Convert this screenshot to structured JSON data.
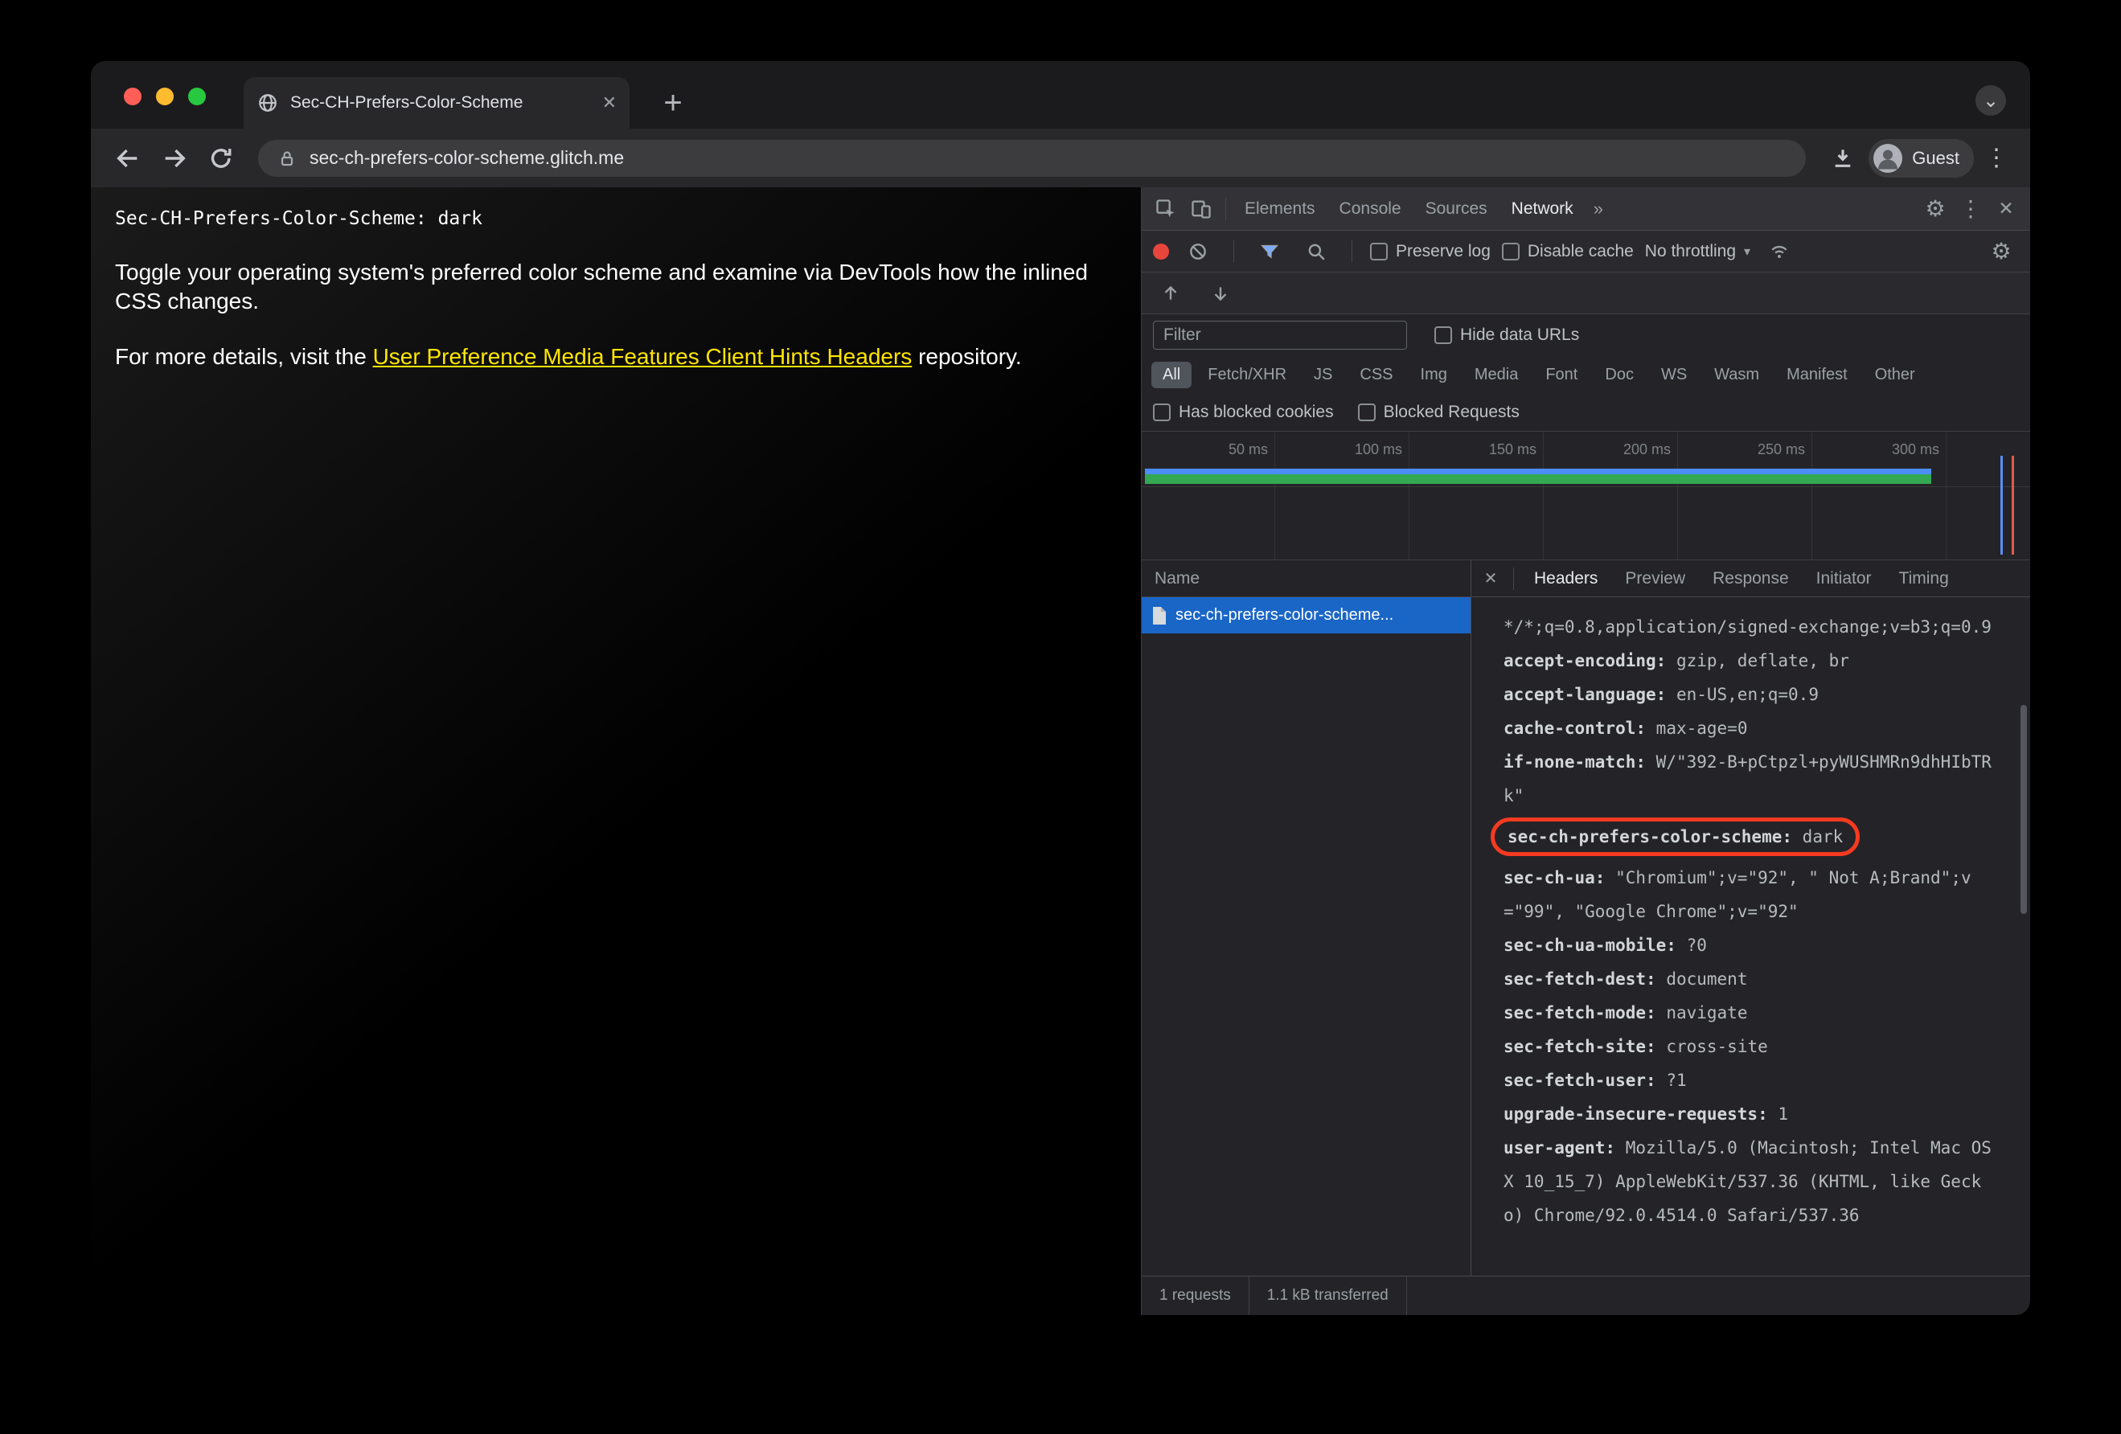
{
  "browser": {
    "tab_title": "Sec-CH-Prefers-Color-Scheme",
    "url": "sec-ch-prefers-color-scheme.glitch.me",
    "profile_label": "Guest"
  },
  "icons": {
    "close": "✕",
    "plus": "+",
    "kebab": "⋮",
    "gear": "⚙",
    "overflow": "»",
    "chevron_down": "▾",
    "collapse_chevron": "⌄"
  },
  "page": {
    "mono_line": "Sec-CH-Prefers-Color-Scheme: dark",
    "para1": "Toggle your operating system's preferred color scheme and examine via DevTools how the inlined CSS changes.",
    "para2_prefix": "For more details, visit the ",
    "link_text": "User Preference Media Features Client Hints Headers",
    "para2_suffix": " repository."
  },
  "devtools": {
    "tabs": [
      {
        "label": "Elements"
      },
      {
        "label": "Console"
      },
      {
        "label": "Sources"
      },
      {
        "label": "Network",
        "selected": true
      }
    ],
    "toolbar": {
      "preserve_log": "Preserve log",
      "disable_cache": "Disable cache",
      "throttling": "No throttling"
    },
    "filter": {
      "placeholder": "Filter",
      "hide_data_urls": "Hide data URLs",
      "chips": [
        {
          "label": "All",
          "selected": true
        },
        {
          "label": "Fetch/XHR"
        },
        {
          "label": "JS"
        },
        {
          "label": "CSS"
        },
        {
          "label": "Img"
        },
        {
          "label": "Media"
        },
        {
          "label": "Font"
        },
        {
          "label": "Doc"
        },
        {
          "label": "WS"
        },
        {
          "label": "Wasm"
        },
        {
          "label": "Manifest"
        },
        {
          "label": "Other"
        }
      ],
      "has_blocked_cookies": "Has blocked cookies",
      "blocked_requests": "Blocked Requests"
    },
    "timeline": {
      "labels": [
        "50 ms",
        "100 ms",
        "150 ms",
        "200 ms",
        "250 ms",
        "300 ms"
      ]
    },
    "requests": {
      "column": "Name",
      "rows": [
        {
          "name": "sec-ch-prefers-color-scheme...",
          "selected": true
        }
      ]
    },
    "details": {
      "tabs": [
        {
          "label": "Headers",
          "selected": true
        },
        {
          "label": "Preview"
        },
        {
          "label": "Response"
        },
        {
          "label": "Initiator"
        },
        {
          "label": "Timing"
        }
      ],
      "headers": [
        {
          "name": "",
          "value": "*/*;q=0.8,application/signed-exchange;v=b3;q=0.9"
        },
        {
          "name": "accept-encoding:",
          "value": "gzip, deflate, br"
        },
        {
          "name": "accept-language:",
          "value": "en-US,en;q=0.9"
        },
        {
          "name": "cache-control:",
          "value": "max-age=0"
        },
        {
          "name": "if-none-match:",
          "value": "W/\"392-B+pCtpzl+pyWUSHMRn9dhHIbTRk\""
        },
        {
          "name": "sec-ch-prefers-color-scheme:",
          "value": "dark",
          "circled": true
        },
        {
          "name": "sec-ch-ua:",
          "value": "\"Chromium\";v=\"92\", \" Not A;Brand\";v=\"99\", \"Google Chrome\";v=\"92\""
        },
        {
          "name": "sec-ch-ua-mobile:",
          "value": "?0"
        },
        {
          "name": "sec-fetch-dest:",
          "value": "document"
        },
        {
          "name": "sec-fetch-mode:",
          "value": "navigate"
        },
        {
          "name": "sec-fetch-site:",
          "value": "cross-site"
        },
        {
          "name": "sec-fetch-user:",
          "value": "?1"
        },
        {
          "name": "upgrade-insecure-requests:",
          "value": "1"
        },
        {
          "name": "user-agent:",
          "value": "Mozilla/5.0 (Macintosh; Intel Mac OS X 10_15_7) AppleWebKit/537.36 (KHTML, like Gecko) Chrome/92.0.4514.0 Safari/537.36"
        }
      ]
    },
    "status": {
      "requests": "1 requests",
      "transferred": "1.1 kB transferred"
    }
  },
  "colors": {
    "selection_blue": "#1a66c7",
    "record_red": "#e8453c",
    "annotation_red": "#f53a21",
    "link_yellow": "#ffe600",
    "bar_green": "#34a853",
    "bar_blue": "#4c8df6",
    "funnel_blue": "#7cacf8",
    "marker_blue": "#5b8ef5",
    "marker_red": "#e25a4e"
  }
}
